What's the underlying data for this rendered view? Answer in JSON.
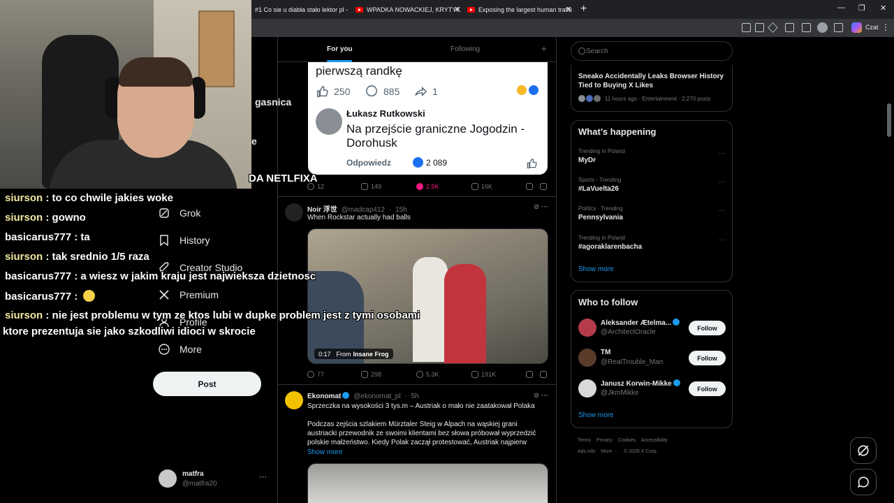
{
  "browser": {
    "tabs": [
      {
        "title": "#1 Co sie u diabła stało lektor pl -"
      },
      {
        "title": "WPADKA NOWACKIEJ, KRYTYKA T"
      },
      {
        "title": "Exposing the largest human traffic"
      }
    ],
    "new_tab_label": "+",
    "chat_button": "Czat"
  },
  "chat": {
    "messages": [
      {
        "user": "siurson",
        "text": "to co chwile jakies woke"
      },
      {
        "user": "siurson",
        "text": "gowno"
      },
      {
        "user": "basicarus777",
        "text": "ta"
      },
      {
        "user": "siurson",
        "text": "tak srednio 1/5 raza"
      },
      {
        "user": "basicarus777",
        "text": "a wiesz w jakim kraju jest najwieksza dzietnosc"
      },
      {
        "user": "basicarus777",
        "text": ""
      },
      {
        "user": "siurson",
        "text": "nie jest problemu w tym ze ktos lubi w dupke problem jest z tymi osobami"
      }
    ],
    "continuation": "ktore prezentuja sie jako szkodliwi idioci w skrocie",
    "fragments": [
      "gasnica",
      "e",
      "DA NETLFIXA"
    ]
  },
  "nav": {
    "items": [
      {
        "label": "Grok",
        "icon": "grok-icon"
      },
      {
        "label": "History",
        "icon": "bookmark-icon"
      },
      {
        "label": "Creator Studio",
        "icon": "rocket-icon"
      },
      {
        "label": "Premium",
        "icon": "x-logo-icon"
      },
      {
        "label": "Profile",
        "icon": "person-icon"
      },
      {
        "label": "More",
        "icon": "more-circle-icon"
      }
    ],
    "post_button": "Post",
    "account": {
      "name": "matfra",
      "handle": "@matfra20"
    }
  },
  "feed": {
    "tabs": [
      "For you",
      "Following"
    ],
    "active_tab": "For you",
    "quoted_card": {
      "text": "pierwszą randkę",
      "likes": "250",
      "comments": "885",
      "shares": "1",
      "reply": {
        "author": "Łukasz Rutkowski",
        "text": "Na przejście graniczne Jogodzin - Dorohusk",
        "action": "Odpowiedz",
        "likes": "2 089"
      }
    },
    "tweet0_stats": {
      "replies": "12",
      "reposts": "149",
      "likes": "2.5K",
      "views": "16K"
    },
    "tweets": [
      {
        "name": "Noir 浮世",
        "handle": "@madcap412",
        "time": "15h",
        "text": "When Rockstar actually had balls",
        "video": {
          "duration": "0:17",
          "from_label": "From",
          "source": "Insane Frog"
        },
        "stats": {
          "replies": "77",
          "reposts": "298",
          "likes": "5.3K",
          "views": "191K"
        }
      },
      {
        "name": "Ekonomat",
        "handle": "@ekonomat_pl",
        "time": "5h",
        "verified": true,
        "text": "Sprzeczka na wysokości 3 tys.m – Austriak o mało nie zaatakował Polaka\n\nPodczas zejścia szlakiem Mürztaler Steig w Alpach na wąskiej grani austriacki przewodnik ze swoimi klientami bez słowa próbował wyprzedzić polskie małżeństwo. Kiedy Polak zaczął protestować, Austriak najpierw",
        "show_more": "Show more"
      }
    ]
  },
  "right": {
    "search_placeholder": "Search",
    "news": {
      "title": "Sneako Accidentally Leaks Browser History Tied to Buying X Likes",
      "meta": "11 hours ago · Entertainment · 2,270 posts"
    },
    "happening": {
      "title": "What’s happening",
      "trends": [
        {
          "context": "Trending in Poland",
          "title": "MyDr"
        },
        {
          "context": "Sports · Trending",
          "title": "#LaVuelta26"
        },
        {
          "context": "Politics · Trending",
          "title": "Pennsylvania"
        },
        {
          "context": "Trending in Poland",
          "title": "#agoraklarenbacha"
        }
      ],
      "show_more": "Show more"
    },
    "who_to_follow": {
      "title": "Who to follow",
      "accounts": [
        {
          "name": "Aleksander Ætelma...",
          "handle": "@ArchitectOracle",
          "button": "Follow"
        },
        {
          "name": "TM",
          "handle": "@RealTrouble_Man",
          "button": "Follow"
        },
        {
          "name": "Janusz Korwin-Mikke",
          "handle": "@JkmMikke",
          "button": "Follow"
        }
      ],
      "show_more": "Show more"
    },
    "footer": [
      "Terms",
      "Privacy",
      "Cookies",
      "Accessibility",
      "Ads info",
      "More ···",
      "© 2026 X Corp."
    ]
  },
  "colors": {
    "accent": "#1d9bf0",
    "like": "#f91880",
    "bg": "#000000",
    "text": "#e7e9ea",
    "muted": "#71767b"
  }
}
